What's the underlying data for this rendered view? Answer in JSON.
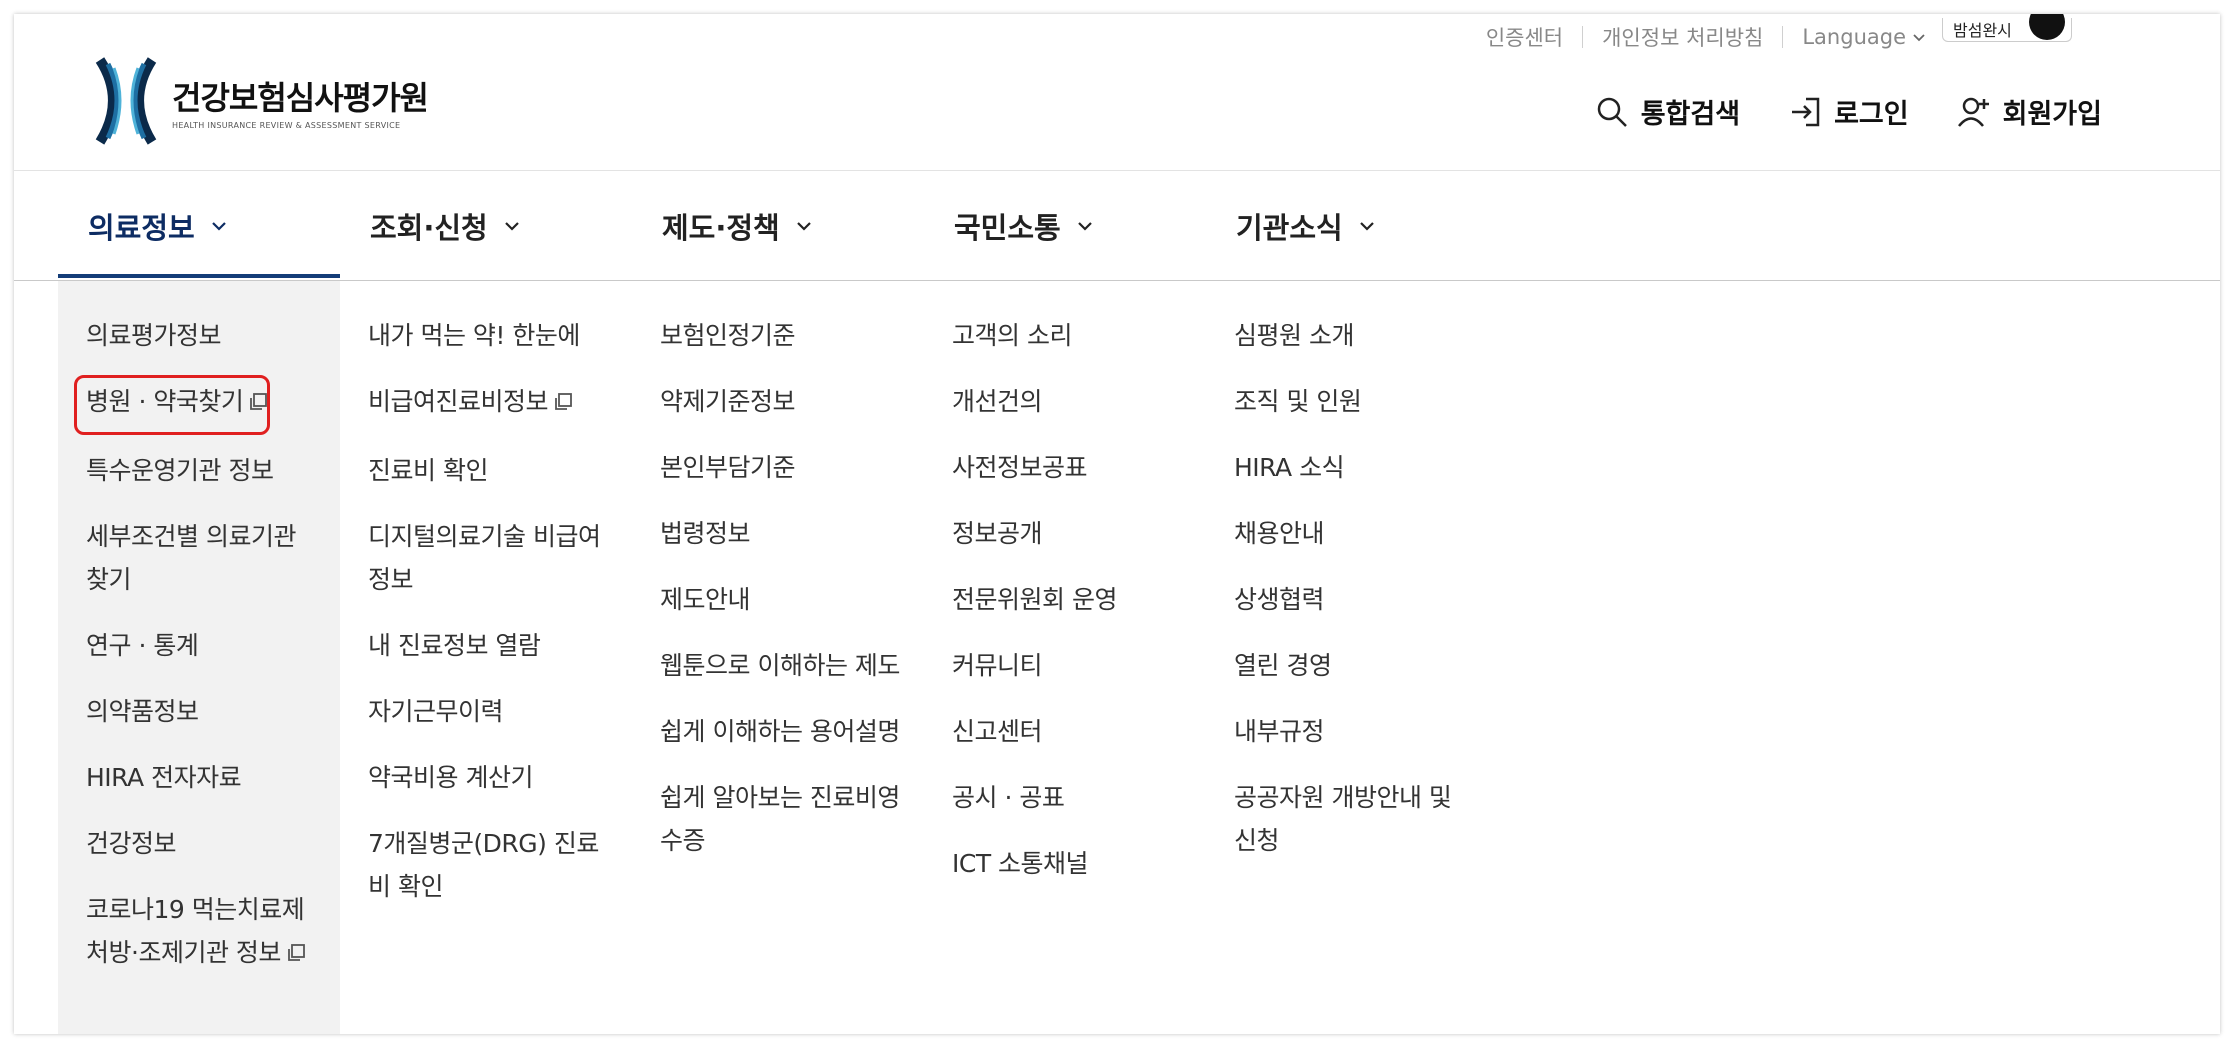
{
  "utility": {
    "cert_center": "인증센터",
    "privacy": "개인정보 처리방침",
    "language": "Language",
    "toggle_label": "밤섬완시"
  },
  "logo": {
    "name": "건강보험심사평가원",
    "sub": "HEALTH INSURANCE REVIEW & ASSESSMENT SERVICE"
  },
  "header": {
    "search": "통합검색",
    "login": "로그인",
    "signup": "회원가입"
  },
  "colors": {
    "active_tab": "#0d2c63",
    "underline": "#143d78",
    "highlight": "#e02020",
    "col_bg": "#f2f2f2"
  },
  "gnb": {
    "tabs": [
      {
        "label": "의료정보"
      },
      {
        "label": "조회·신청"
      },
      {
        "label": "제도·정책"
      },
      {
        "label": "국민소통"
      },
      {
        "label": "기관소식"
      }
    ]
  },
  "menu": {
    "col1": [
      "의료평가정보",
      "병원 · 약국찾기",
      "특수운영기관 정보",
      "세부조건별 의료기관 찾기",
      "연구 · 통계",
      "의약품정보",
      "HIRA 전자자료",
      "건강정보",
      "코로나19 먹는치료제 처방·조제기관 정보"
    ],
    "col2": [
      "내가 먹는 약! 한눈에",
      "비급여진료비정보",
      "진료비 확인",
      "디지털의료기술 비급여정보",
      "내 진료정보 열람",
      "자기근무이력",
      "약국비용 계산기",
      "7개질병군(DRG) 진료비 확인"
    ],
    "col3": [
      "보험인정기준",
      "약제기준정보",
      "본인부담기준",
      "법령정보",
      "제도안내",
      "웹툰으로 이해하는 제도",
      "쉽게 이해하는 용어설명",
      "쉽게 알아보는 진료비영수증"
    ],
    "col4": [
      "고객의 소리",
      "개선건의",
      "사전정보공표",
      "정보공개",
      "전문위원회 운영",
      "커뮤니티",
      "신고센터",
      "공시 · 공표",
      "ICT 소통채널"
    ],
    "col5": [
      "심평원 소개",
      "조직 및 인원",
      "HIRA 소식",
      "채용안내",
      "상생협력",
      "열린 경영",
      "내부규정",
      "공공자원 개방안내 및 신청"
    ]
  }
}
